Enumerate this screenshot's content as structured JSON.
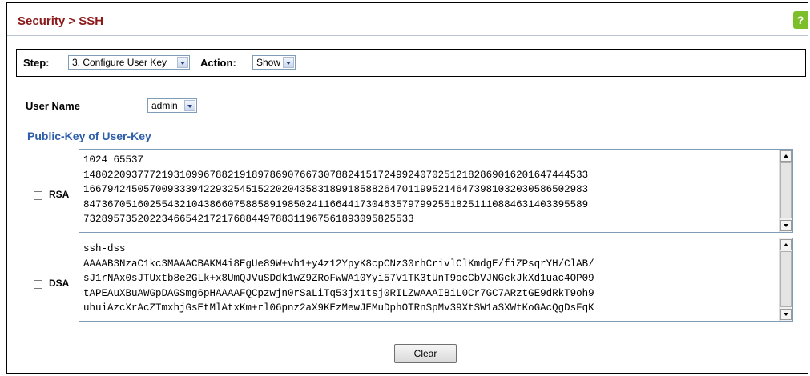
{
  "breadcrumb": "Security > SSH",
  "help_icon": "?",
  "step_bar": {
    "step_label": "Step:",
    "step_value": "3. Configure User Key",
    "action_label": "Action:",
    "action_value": "Show"
  },
  "user_name": {
    "label": "User Name",
    "value": "admin"
  },
  "section_title": "Public-Key of User-Key",
  "rsa": {
    "label": "RSA",
    "checked": false,
    "key_text": "1024 65537\n148022093777219310996788219189786907667307882415172499240702512182869016201647444533\n166794245057009333942293254515220204358318991858826470119952146473981032030586502983\n847367051602554321043866075885891985024116644173046357979925518251110884631403395589\n7328957352022346654217217688449788311967561893095825533"
  },
  "dsa": {
    "label": "DSA",
    "checked": false,
    "key_text": "ssh-dss\nAAAAB3NzaC1kc3MAAACBAKM4i8EgUe89W+vh1+y4z12YpyK8cpCNz30rhCrivlClKmdgE/fiZPsqrYH/ClAB/\nsJ1rNAx0sJTUxtb8e2GLk+x8UmQJVuSDdk1wZ9ZRoFwWA10Yyi57V1TK3tUnT9ocCbVJNGckJkXd1uac4OP09\ntAPEAuXBuAWGpDAGSmg6pHAAAAFQCpzwjn0rSaLiTq53jx1tsj0RILZwAAAIBiL0Cr7GC7ARztGE9dRkT9oh9\nuhuiAzcXrAcZTmxhjGsEtMlAtxKm+rl06pnz2aX9KEzMewJEMuDphOTRnSpMv39XtSW1aSXWtKoGAcQgDsFqK"
  },
  "clear_button": "Clear"
}
